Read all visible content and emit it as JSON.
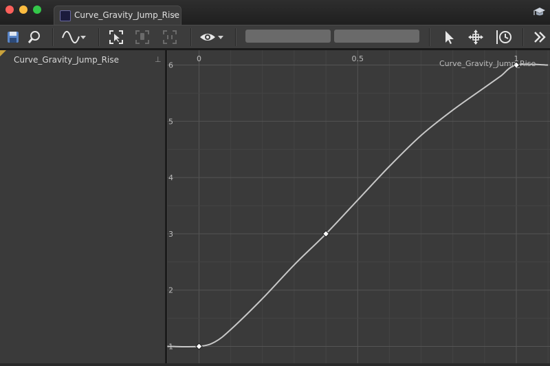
{
  "window": {
    "tab_title": "Curve_Gravity_Jump_Rise",
    "tab_close": "×"
  },
  "toolbar": {
    "icons": [
      "save-icon",
      "find-in-browser-icon",
      "curve-type-icon",
      "select-icon",
      "frame-icon",
      "frame-all-icon",
      "visibility-icon",
      "pointer-icon",
      "pan-icon",
      "time-icon",
      "more-icon"
    ]
  },
  "sidebar": {
    "curve_name": "Curve_Gravity_Jump_Rise",
    "pin_glyph": "⊥"
  },
  "graph": {
    "curve_label": "Curve_Gravity_Jump_Rise",
    "x_ticks": [
      "0",
      "0.5",
      "1"
    ],
    "y_ticks": [
      "1",
      "2",
      "3",
      "4",
      "5",
      "6"
    ]
  },
  "chart_data": {
    "type": "line",
    "x_ticks": [
      0,
      0.5,
      1
    ],
    "y_ticks": [
      1,
      2,
      3,
      4,
      5,
      6
    ],
    "series": [
      {
        "name": "Curve_Gravity_Jump_Rise",
        "x": [
          -0.1,
          0,
          0.05,
          0.1,
          0.2,
          0.3,
          0.4,
          0.5,
          0.6,
          0.7,
          0.8,
          0.9,
          0.95,
          1.0,
          1.1
        ],
        "y": [
          1.0,
          1.0,
          1.08,
          1.3,
          1.85,
          2.45,
          3.0,
          3.6,
          4.2,
          4.75,
          5.2,
          5.6,
          5.8,
          6.0,
          6.0
        ]
      }
    ],
    "keyframes": [
      {
        "x": 0,
        "y": 1
      },
      {
        "x": 0.4,
        "y": 3
      },
      {
        "x": 1,
        "y": 6
      }
    ],
    "colors": {
      "curve": "#c8c8c8",
      "background": "#3a3a3a",
      "grid": "#4a4a4a"
    }
  }
}
